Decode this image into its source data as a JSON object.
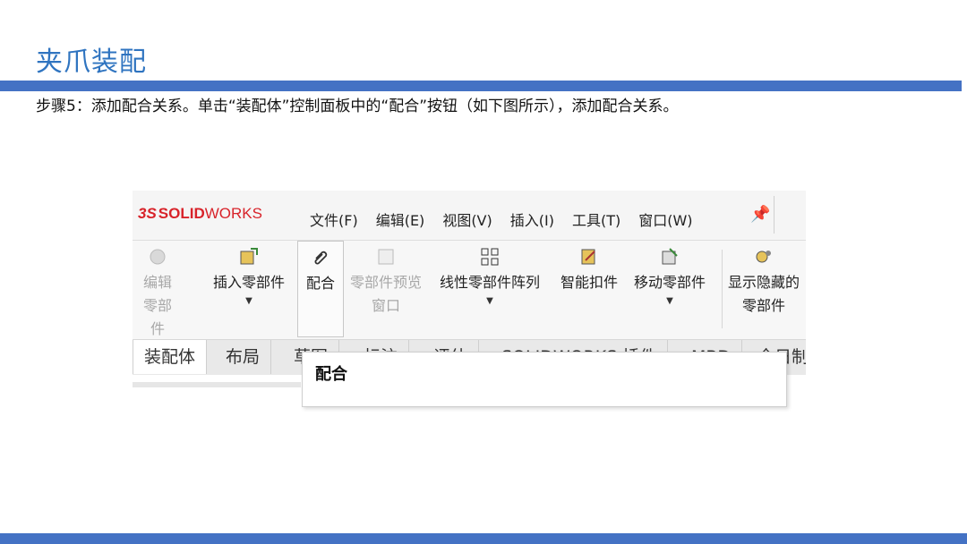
{
  "slide": {
    "title": "夹爪装配",
    "instruction": "步骤5：添加配合关系。单击“装配体”控制面板中的“配合”按钮（如下图所示），添加配合关系。"
  },
  "app": {
    "logo_ds": "3S",
    "logo_solid": "SOLID",
    "logo_works": "WORKS"
  },
  "menu": [
    "文件(F)",
    "编辑(E)",
    "视图(V)",
    "插入(I)",
    "工具(T)",
    "窗口(W)"
  ],
  "toolbar": {
    "edit_component": "编辑零部件",
    "insert_components": "插入零部件",
    "mate": "配合",
    "component_preview": "零部件预览窗口",
    "linear_pattern": "线性零部件阵列",
    "smart_fasteners": "智能扣件",
    "move_component": "移动零部件",
    "show_hidden": "显示隐藏的零部件"
  },
  "tabs": [
    "装配体",
    "布局",
    "草图",
    "标注",
    "评估",
    "SOLIDWORKS 插件",
    "MBD",
    "全日制"
  ],
  "tooltip": {
    "title": "配合"
  },
  "colors": {
    "accent": "#4472c4",
    "title": "#2f74c0",
    "logo": "#d8232a"
  }
}
